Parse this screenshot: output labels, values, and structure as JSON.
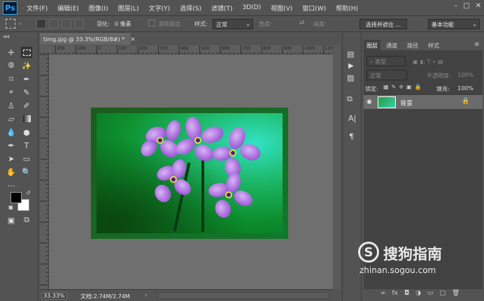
{
  "app": {
    "logo": "Ps"
  },
  "menu": [
    "文件(F)",
    "编辑(E)",
    "图像(I)",
    "图层(L)",
    "文字(Y)",
    "选择(S)",
    "滤镜(T)",
    "3D(D)",
    "视图(V)",
    "窗口(W)",
    "帮助(H)"
  ],
  "options": {
    "feather_label": "羽化:",
    "feather_value": "0 像素",
    "antialias_label": "消除锯齿",
    "style_label": "样式:",
    "style_value": "正常",
    "width_label": "宽度:",
    "height_label": "高度:",
    "select_mask_button": "选择并遮住 ...",
    "workspace": "基本功能"
  },
  "document": {
    "tab_title": "timg.jpg @ 33.3%(RGB/8#) *",
    "ruler_ticks": [
      "200",
      "100",
      "0",
      "100",
      "200",
      "300",
      "400",
      "500",
      "600",
      "700",
      "800",
      "900",
      "1000",
      "1100",
      "1200"
    ],
    "zoom": "33.33%",
    "doc_info": "文档:2.74M/2.74M"
  },
  "layers_panel": {
    "tabs": [
      "图层",
      "通道",
      "路径",
      "样式"
    ],
    "filter_kind": "类型",
    "blend_mode": "正常",
    "opacity_label": "不透明度:",
    "opacity_value": "100%",
    "lock_label": "锁定:",
    "fill_label": "填充:",
    "fill_value": "100%",
    "layer_name": "背景"
  },
  "watermark": {
    "brand": "搜狗指南",
    "url": "zhinan.sogou.com"
  },
  "colors": {
    "ui_bg": "#535353",
    "canvas_bg": "#6f6f6f",
    "panel_dark": "#424242",
    "logo_blue": "#31a8ff"
  }
}
